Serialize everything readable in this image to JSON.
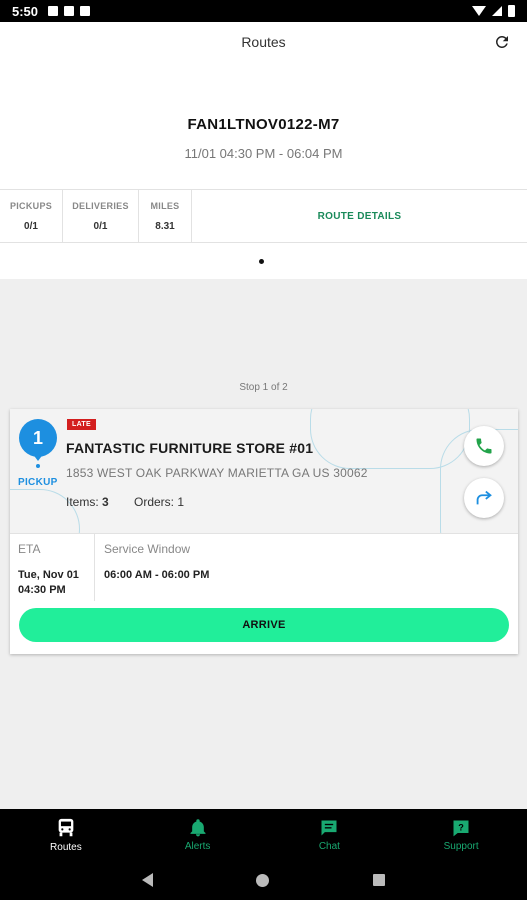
{
  "status_bar": {
    "time": "5:50"
  },
  "app_bar": {
    "title": "Routes"
  },
  "route": {
    "id": "FAN1LTNOV0122-M7",
    "time_window": "11/01 04:30 PM - 06:04 PM"
  },
  "stats": {
    "pickups_label": "PICKUPS",
    "pickups_value": "0/1",
    "deliveries_label": "DELIVERIES",
    "deliveries_value": "0/1",
    "miles_label": "MILES",
    "miles_value": "8.31",
    "route_details_label": "ROUTE DETAILS"
  },
  "stop_indicator": "Stop 1 of 2",
  "stop": {
    "number": "1",
    "type_label": "PICKUP",
    "badge": "LATE",
    "name": "FANTASTIC FURNITURE STORE #01",
    "address": "1853 WEST OAK PARKWAY MARIETTA GA US 30062",
    "items_label": "Items:",
    "items_value": "3",
    "orders_label": "Orders:",
    "orders_value": "1",
    "eta_label": "ETA",
    "eta_date": "Tue, Nov 01",
    "eta_time": "04:30 PM",
    "service_window_label": "Service Window",
    "service_window_value": "06:00 AM - 06:00 PM",
    "arrive_label": "ARRIVE"
  },
  "colors": {
    "accent_green": "#21ee9a",
    "pin_blue": "#1d8fe0",
    "late_red": "#d31f1f",
    "nav_green": "#19a971"
  },
  "bottom_nav": {
    "routes": "Routes",
    "alerts": "Alerts",
    "chat": "Chat",
    "support": "Support"
  },
  "icons": [
    "refresh-icon",
    "phone-icon",
    "directions-icon",
    "truck-icon",
    "bell-icon",
    "chat-icon",
    "support-icon"
  ]
}
